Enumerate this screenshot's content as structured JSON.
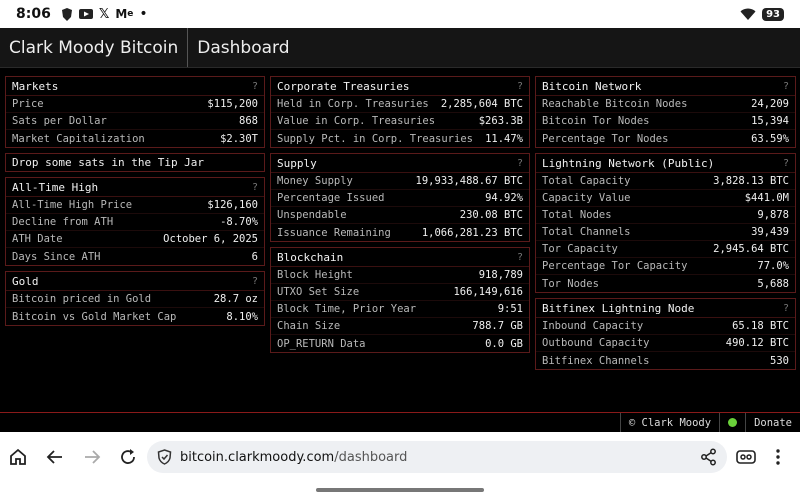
{
  "status": {
    "time": "8:06",
    "battery": "93"
  },
  "header": {
    "brand": "Clark Moody Bitcoin",
    "page": "Dashboard"
  },
  "markets": {
    "title": "Markets",
    "help": "?",
    "rows": [
      {
        "label": "Price",
        "value": "$115,200"
      },
      {
        "label": "Sats per Dollar",
        "value": "868"
      },
      {
        "label": "Market Capitalization",
        "value": "$2.30T"
      }
    ]
  },
  "tipjar": "Drop some sats in the Tip Jar",
  "ath": {
    "title": "All-Time High",
    "help": "?",
    "rows": [
      {
        "label": "All-Time High Price",
        "value": "$126,160"
      },
      {
        "label": "Decline from ATH",
        "value": "-8.70%"
      },
      {
        "label": "ATH Date",
        "value": "October 6, 2025"
      },
      {
        "label": "Days Since ATH",
        "value": "6"
      }
    ]
  },
  "gold": {
    "title": "Gold",
    "help": "?",
    "rows": [
      {
        "label": "Bitcoin priced in Gold",
        "value": "28.7 oz"
      },
      {
        "label": "Bitcoin vs Gold Market Cap",
        "value": "8.10%"
      }
    ]
  },
  "treasuries": {
    "title": "Corporate Treasuries",
    "help": "?",
    "rows": [
      {
        "label": "Held in Corp. Treasuries",
        "value": "2,285,604 BTC"
      },
      {
        "label": "Value in Corp. Treasuries",
        "value": "$263.3B"
      },
      {
        "label": "Supply Pct. in Corp. Treasuries",
        "value": "11.47%"
      }
    ]
  },
  "supply": {
    "title": "Supply",
    "help": "?",
    "rows": [
      {
        "label": "Money Supply",
        "value": "19,933,488.67 BTC"
      },
      {
        "label": "Percentage Issued",
        "value": "94.92%"
      },
      {
        "label": "Unspendable",
        "value": "230.08 BTC"
      },
      {
        "label": "Issuance Remaining",
        "value": "1,066,281.23 BTC"
      }
    ]
  },
  "blockchain": {
    "title": "Blockchain",
    "help": "?",
    "rows": [
      {
        "label": "Block Height",
        "value": "918,789"
      },
      {
        "label": "UTXO Set Size",
        "value": "166,149,616"
      },
      {
        "label": "Block Time, Prior Year",
        "value": "9:51"
      },
      {
        "label": "Chain Size",
        "value": "788.7 GB"
      },
      {
        "label": "OP_RETURN Data",
        "value": "0.0 GB"
      }
    ]
  },
  "network": {
    "title": "Bitcoin Network",
    "help": "?",
    "rows": [
      {
        "label": "Reachable Bitcoin Nodes",
        "value": "24,209"
      },
      {
        "label": "Bitcoin Tor Nodes",
        "value": "15,394"
      },
      {
        "label": "Percentage Tor Nodes",
        "value": "63.59%"
      }
    ]
  },
  "lightning": {
    "title": "Lightning Network (Public)",
    "help": "?",
    "rows": [
      {
        "label": "Total Capacity",
        "value": "3,828.13 BTC"
      },
      {
        "label": "Capacity Value",
        "value": "$441.0M"
      },
      {
        "label": "Total Nodes",
        "value": "9,878"
      },
      {
        "label": "Total Channels",
        "value": "39,439"
      },
      {
        "label": "Tor Capacity",
        "value": "2,945.64 BTC"
      },
      {
        "label": "Percentage Tor Capacity",
        "value": "77.0%"
      },
      {
        "label": "Tor Nodes",
        "value": "5,688"
      }
    ]
  },
  "bitfinex": {
    "title": "Bitfinex Lightning Node",
    "help": "?",
    "rows": [
      {
        "label": "Inbound Capacity",
        "value": "65.18 BTC"
      },
      {
        "label": "Outbound Capacity",
        "value": "490.12 BTC"
      },
      {
        "label": "Bitfinex Channels",
        "value": "530"
      }
    ]
  },
  "footer": {
    "copyright": "© Clark Moody",
    "donate": "Donate",
    "status_color": "#6ad13a"
  },
  "browser": {
    "url_host": "bitcoin.clarkmoody.com",
    "url_path": "/dashboard"
  },
  "colors": {
    "panel_border": "#5a1a1a",
    "footer_border": "#8a1a1a",
    "background": "#000000"
  }
}
